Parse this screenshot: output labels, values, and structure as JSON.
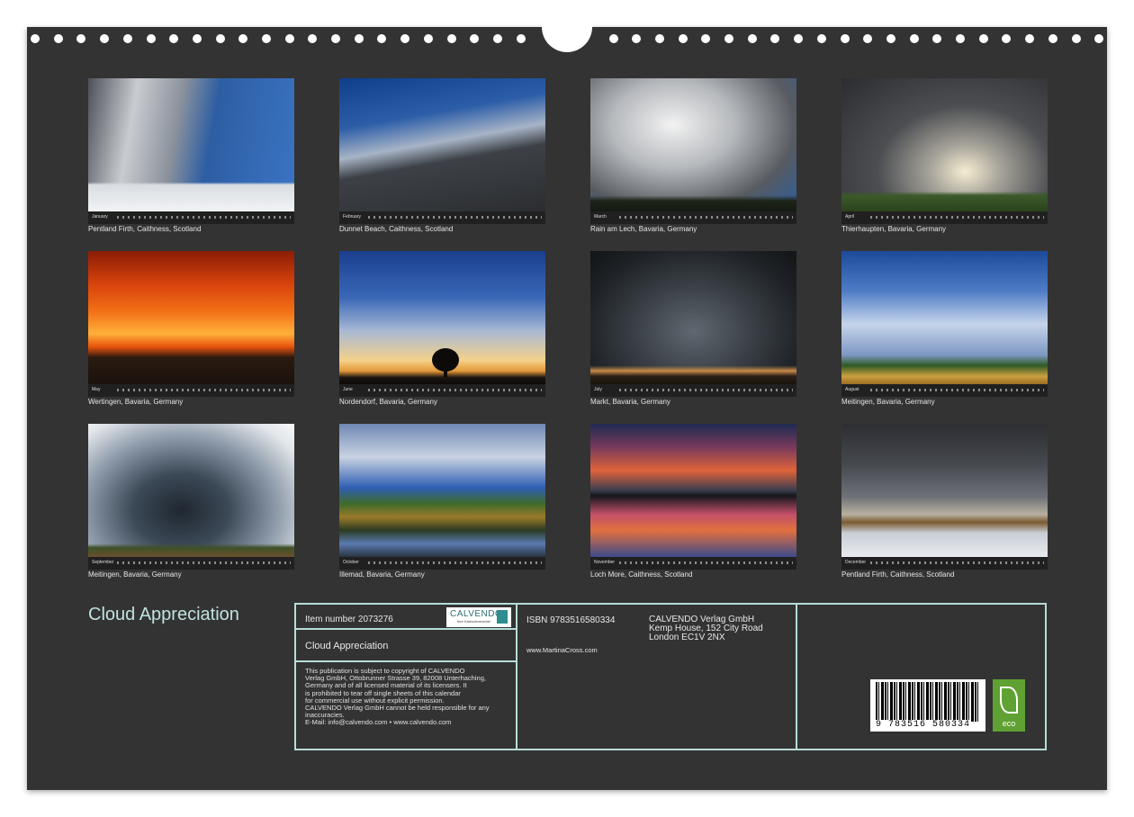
{
  "photos": [
    {
      "month": "January",
      "caption": "Pentland Firth, Caithness, Scotland"
    },
    {
      "month": "February",
      "caption": "Dunnet Beach, Caithness, Scotland"
    },
    {
      "month": "March",
      "caption": "Rain am Lech, Bavaria, Germany"
    },
    {
      "month": "April",
      "caption": "Thierhaupten, Bavaria, Germany"
    },
    {
      "month": "May",
      "caption": "Wertingen, Bavaria, Germany"
    },
    {
      "month": "June",
      "caption": "Nordendorf, Bavaria, Germany"
    },
    {
      "month": "July",
      "caption": "Markt, Bavaria, Germany"
    },
    {
      "month": "August",
      "caption": "Meitingen, Bavaria, Germany"
    },
    {
      "month": "September",
      "caption": "Meitingen, Bavaria, Germany"
    },
    {
      "month": "October",
      "caption": "Illemad, Bavaria, Germany"
    },
    {
      "month": "November",
      "caption": "Loch More, Caithness, Scotland"
    },
    {
      "month": "December",
      "caption": "Pentland Firth, Caithness, Scotland"
    }
  ],
  "cover_title": "Cloud Appreciation",
  "info": {
    "item_number": "Item number 2073276",
    "logo_text": "CALVENDO",
    "logo_tagline": "Ihre Kalendermacher",
    "title": "Cloud Appreciation",
    "legal": [
      "This publication is subject to copyright of CALVENDO",
      "Verlag GmbH, Ottobrunner Strasse 39, 82008 Unterhaching,",
      "Germany and of all licensed material of its licensers. It",
      "is prohibited to tear off single sheets of this calendar",
      "for commercial use without explicit permission.",
      "CALVENDO Verlag GmbH cannot be held responsible for any",
      "inaccuracies.",
      "E-Mail: info@calvendo.com • www.calvendo.com"
    ],
    "isbn": "ISBN 9783516580334",
    "website": "www.MartinaCross.com",
    "publisher": [
      "CALVENDO Verlag GmbH",
      "Kemp House, 152 City Road",
      "London EC1V 2NX"
    ],
    "barcode_number": "9 783516 580334",
    "eco_label": "eco"
  },
  "colors": {
    "background": "#333333",
    "accent": "#b7dcd7",
    "title": "#bfe3e0"
  }
}
